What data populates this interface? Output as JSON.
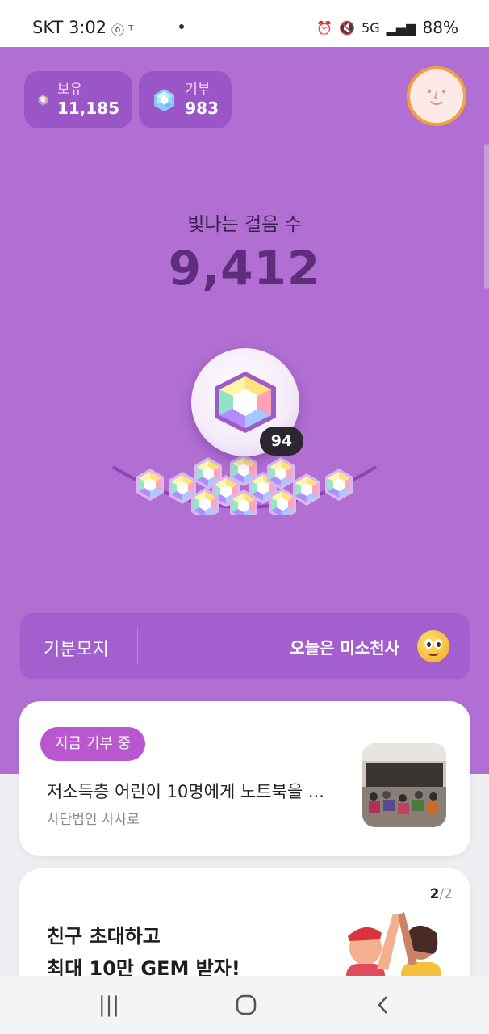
{
  "status_bar": {
    "carrier_time": "SKT 3:02",
    "battery": "88%",
    "network": "5G"
  },
  "wallet": {
    "owned": {
      "label": "보유",
      "value": "11,185"
    },
    "donated": {
      "label": "기부",
      "value": "983"
    }
  },
  "steps": {
    "label": "빛나는 걸음 수",
    "value": "9,412"
  },
  "gem_counter": "94",
  "fundraising_banner": {
    "left_label": "기분모지",
    "right_label": "오늘은 미소천사"
  },
  "donation_card": {
    "badge": "지금 기부 중",
    "title": "저소득층 어린이 10명에게 노트북을 ...",
    "organization": "사단법인 사사로"
  },
  "promo_card": {
    "page_current": "2",
    "page_total": "/2",
    "line1": "친구 초대하고",
    "line2": "최대 10만 GEM 받자!"
  },
  "colors": {
    "hero_bg": "#b16fd4",
    "chip_bg": "#9a55c6",
    "steps_value": "#5e2e7d",
    "badge_pink": "#b957cf"
  }
}
